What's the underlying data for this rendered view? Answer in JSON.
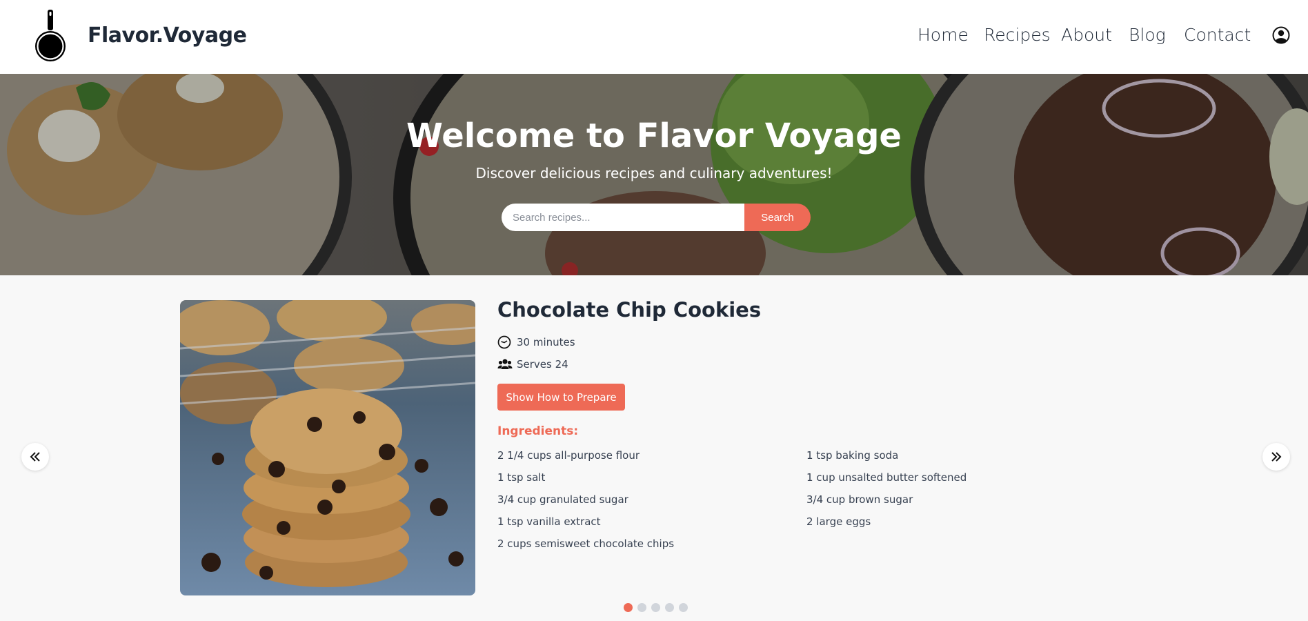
{
  "header": {
    "brand": "Flavor.Voyage",
    "nav": [
      {
        "label": "Home"
      },
      {
        "label": "Recipes"
      },
      {
        "label": "About"
      },
      {
        "label": "Blog"
      },
      {
        "label": "Contact"
      }
    ],
    "user_icon": "user-circle-icon",
    "logo_icon": "frying-pan-icon"
  },
  "hero": {
    "title": "Welcome to Flavor Voyage",
    "subtitle": "Discover delicious recipes and culinary adventures!",
    "search_placeholder": "Search recipes...",
    "search_value": "",
    "search_button": "Search"
  },
  "recipe": {
    "title": "Chocolate Chip Cookies",
    "time": "30 minutes",
    "time_icon": "clock-icon",
    "serves": "Serves 24",
    "serves_icon": "users-icon",
    "prepare_button": "Show How to Prepare",
    "ingredients_heading": "Ingredients:",
    "ingredients_left": [
      "2 1/4 cups all-purpose flour",
      "1 tsp salt",
      "3/4 cup granulated sugar",
      "1 tsp vanilla extract",
      "2 cups semisweet chocolate chips"
    ],
    "ingredients_right": [
      "1 tsp baking soda",
      "1 cup unsalted butter softened",
      "3/4 cup brown sugar",
      "2 large eggs"
    ]
  },
  "carousel": {
    "prev_icon": "double-chevron-left-icon",
    "next_icon": "double-chevron-right-icon",
    "slide_count": 5,
    "active_slide": 1
  },
  "colors": {
    "accent": "#ee6a56",
    "text": "#1f2937",
    "dot_inactive": "#d1d5db",
    "background": "#f8f8f8"
  }
}
